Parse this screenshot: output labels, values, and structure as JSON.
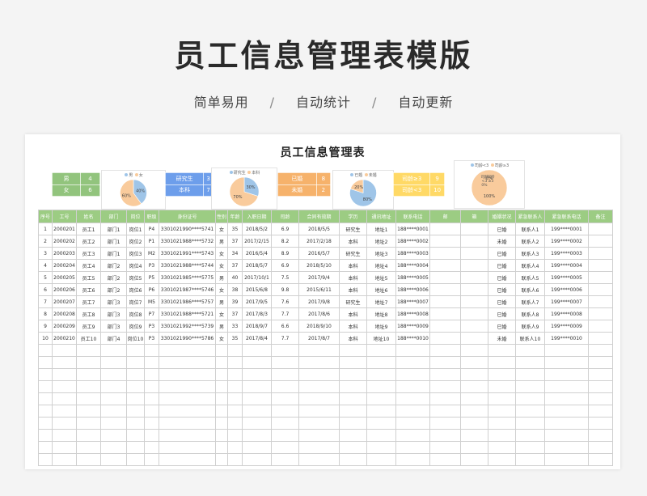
{
  "banner": {
    "title": "员工信息管理表模版",
    "tags": [
      "简单易用",
      "自动统计",
      "自动更新"
    ],
    "separator": "/"
  },
  "sheet": {
    "title": "员工信息管理表",
    "gender_stats": {
      "color": "#92c47d",
      "rows": [
        [
          "男",
          "4"
        ],
        [
          "女",
          "6"
        ]
      ]
    },
    "edu_stats": {
      "color": "#6d9eeb",
      "rows": [
        [
          "研究生",
          "3"
        ],
        [
          "本科",
          "7"
        ]
      ]
    },
    "marital_stats": {
      "color": "#f6b26b",
      "rows": [
        [
          "已婚",
          "8"
        ],
        [
          "未婚",
          "2"
        ]
      ]
    },
    "contract_stats": {
      "color": "#ffd966",
      "rows": [
        [
          "司龄≥3",
          "9"
        ],
        [
          "司龄<3",
          "10"
        ]
      ]
    },
    "pies": [
      {
        "legend": [
          "男",
          "女"
        ],
        "colors": [
          "#9fc5e8",
          "#f9cb9c"
        ],
        "values": [
          40,
          60
        ],
        "labels": [
          "40%",
          "60%"
        ]
      },
      {
        "legend": [
          "研究生",
          "本科"
        ],
        "colors": [
          "#9fc5e8",
          "#f9cb9c"
        ],
        "values": [
          30,
          70
        ],
        "labels": [
          "30%",
          "70%"
        ]
      },
      {
        "legend": [
          "已婚",
          "未婚"
        ],
        "colors": [
          "#9fc5e8",
          "#f9cb9c"
        ],
        "values": [
          80,
          20
        ],
        "labels": [
          "80%",
          "20%"
        ]
      },
      {
        "legend": [
          "司龄<3",
          "司龄≥3"
        ],
        "colors": [
          "#9fc5e8",
          "#f9cb9c"
        ],
        "values": [
          0,
          100
        ],
        "labels": [
          "0%",
          "100%"
        ],
        "extra": [
          "司龄",
          "<3",
          "0%",
          "司龄",
          "≥3"
        ]
      }
    ],
    "columns": [
      "序号",
      "工号",
      "姓名",
      "部门",
      "岗位",
      "职级",
      "身份证号",
      "性别",
      "年龄",
      "入职日期",
      "司龄",
      "合同有效期",
      "学历",
      "通讯地址",
      "联系电话",
      "邮",
      "箱",
      "婚姻状况",
      "紧急联系人",
      "紧急联系电话",
      "备注"
    ],
    "rows": [
      [
        "1",
        "2000201",
        "员工1",
        "部门1",
        "岗位1",
        "P4",
        "3301021990****5741",
        "女",
        "35",
        "2018/5/2",
        "6.9",
        "2018/5/5",
        "研究生",
        "地址1",
        "188****0001",
        "",
        "",
        "已婚",
        "联系人1",
        "199****0001",
        ""
      ],
      [
        "2",
        "2000202",
        "员工2",
        "部门1",
        "岗位2",
        "P1",
        "3301021988****5732",
        "男",
        "37",
        "2017/2/15",
        "8.2",
        "2017/2/18",
        "本科",
        "地址2",
        "188****0002",
        "",
        "",
        "未婚",
        "联系人2",
        "199****0002",
        ""
      ],
      [
        "3",
        "2000203",
        "员工3",
        "部门1",
        "岗位3",
        "M2",
        "3301021991****5743",
        "女",
        "34",
        "2016/5/4",
        "8.9",
        "2016/5/7",
        "研究生",
        "地址3",
        "188****0003",
        "",
        "",
        "已婚",
        "联系人3",
        "199****0003",
        ""
      ],
      [
        "4",
        "2000204",
        "员工4",
        "部门2",
        "岗位4",
        "P3",
        "3301021988****5744",
        "女",
        "37",
        "2018/5/7",
        "6.9",
        "2018/5/10",
        "本科",
        "地址4",
        "188****0004",
        "",
        "",
        "已婚",
        "联系人4",
        "199****0004",
        ""
      ],
      [
        "5",
        "2000205",
        "员工5",
        "部门2",
        "岗位5",
        "P5",
        "3301021985****5775",
        "男",
        "40",
        "2017/10/1",
        "7.5",
        "2017/9/4",
        "本科",
        "地址5",
        "188****0005",
        "",
        "",
        "已婚",
        "联系人5",
        "199****0005",
        ""
      ],
      [
        "6",
        "2000206",
        "员工6",
        "部门2",
        "岗位6",
        "P6",
        "3301021987****5746",
        "女",
        "38",
        "2015/6/8",
        "9.8",
        "2015/6/11",
        "本科",
        "地址6",
        "188****0006",
        "",
        "",
        "已婚",
        "联系人6",
        "199****0006",
        ""
      ],
      [
        "7",
        "2000207",
        "员工7",
        "部门3",
        "岗位7",
        "M5",
        "3301021986****5757",
        "男",
        "39",
        "2017/9/5",
        "7.6",
        "2017/9/8",
        "研究生",
        "地址7",
        "188****0007",
        "",
        "",
        "已婚",
        "联系人7",
        "199****0007",
        ""
      ],
      [
        "8",
        "2000208",
        "员工8",
        "部门3",
        "岗位8",
        "P7",
        "3301021988****5721",
        "女",
        "37",
        "2017/8/3",
        "7.7",
        "2017/8/6",
        "本科",
        "地址8",
        "188****0008",
        "",
        "",
        "已婚",
        "联系人8",
        "199****0008",
        ""
      ],
      [
        "9",
        "2000209",
        "员工9",
        "部门3",
        "岗位9",
        "P3",
        "3301021992****5739",
        "男",
        "33",
        "2018/9/7",
        "6.6",
        "2018/9/10",
        "本科",
        "地址9",
        "188****0009",
        "",
        "",
        "已婚",
        "联系人9",
        "199****0009",
        ""
      ],
      [
        "10",
        "2000210",
        "员工10",
        "部门4",
        "岗位10",
        "P3",
        "3301021990****5786",
        "女",
        "35",
        "2017/8/4",
        "7.7",
        "2017/8/7",
        "本科",
        "地址10",
        "188****0010",
        "",
        "",
        "未婚",
        "联系人10",
        "199****0010",
        ""
      ]
    ],
    "empty_rows": 10,
    "header_color": "#9ccc83"
  }
}
